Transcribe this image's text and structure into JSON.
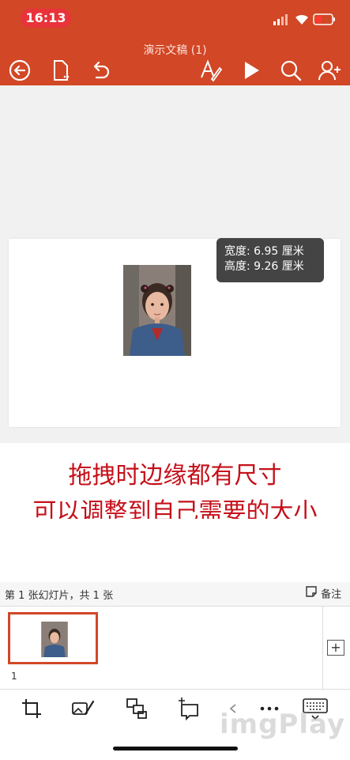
{
  "status": {
    "time": "16:13"
  },
  "header": {
    "title": "演示文稿 (1)"
  },
  "tooltip": {
    "width_line": "宽度: 6.95 厘米",
    "height_line": "高度: 9.26 厘米"
  },
  "caption": {
    "line1": "拖拽时边缘都有尺寸",
    "line2": "可以调整到自己需要的大小"
  },
  "statusbar": {
    "slide_count": "第 1 张幻灯片，共 1 张",
    "notes_label": "备注"
  },
  "thumbnails": [
    {
      "number": "1"
    }
  ],
  "watermark": "imgPlay",
  "colors": {
    "brand": "#d24726",
    "caption": "#c5101a",
    "tooltip_bg": "#444444"
  }
}
